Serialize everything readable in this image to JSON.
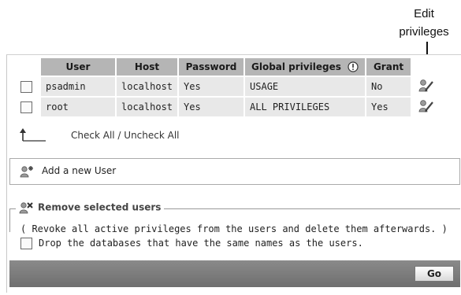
{
  "callout": {
    "line1": "Edit",
    "line2": "privileges"
  },
  "table": {
    "headers": [
      "User",
      "Host",
      "Password",
      "Global privileges",
      "Grant"
    ],
    "rows": [
      {
        "user": "psadmin",
        "host": "localhost",
        "password": "Yes",
        "privileges": "USAGE",
        "grant": "No"
      },
      {
        "user": "root",
        "host": "localhost",
        "password": "Yes",
        "privileges": "ALL PRIVILEGES",
        "grant": "Yes"
      }
    ]
  },
  "check_all": {
    "check": "Check All",
    "separator": " / ",
    "uncheck": "Uncheck All"
  },
  "add_user": {
    "label": "Add a new User"
  },
  "remove": {
    "legend": "Remove selected users",
    "description": "( Revoke all active privileges from the users and delete them afterwards. )",
    "drop_label": "Drop the databases that have the same names as the users."
  },
  "footer": {
    "go_label": "Go"
  },
  "icons": {
    "info": "info-icon",
    "edit": "edit-privileges-icon",
    "add_user": "add-user-icon",
    "remove_user": "remove-user-icon"
  }
}
